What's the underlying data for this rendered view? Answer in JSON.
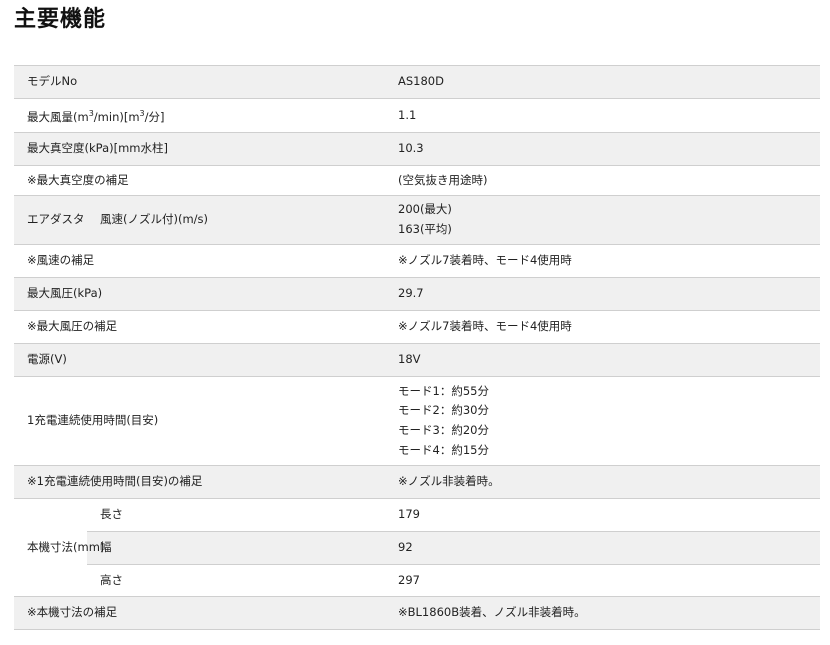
{
  "title": "主要機能",
  "rows": {
    "model": {
      "label": "モデルNo",
      "value": "AS180D"
    },
    "airflow": {
      "label_pre": "最大風量(m",
      "label_sup1": "3",
      "label_mid": "/min)[m",
      "label_sup2": "3",
      "label_post": "/分]",
      "value": "1.1"
    },
    "vacuum": {
      "label": "最大真空度(kPa)[mm水柱]",
      "value": "10.3"
    },
    "vacuum_note": {
      "label": "※最大真空度の補足",
      "value": "(空気抜き用途時)"
    },
    "air_duster": {
      "label": "エアダスタ",
      "sublabel": "風速(ノズル付)(m/s)",
      "values": [
        "200(最大)",
        "163(平均)"
      ]
    },
    "speed_note": {
      "label": "※風速の補足",
      "value": "※ノズル7装着時、モード4使用時"
    },
    "pressure": {
      "label": "最大風圧(kPa)",
      "value": "29.7"
    },
    "pressure_note": {
      "label": "※最大風圧の補足",
      "value": "※ノズル7装着時、モード4使用時"
    },
    "voltage": {
      "label": "電源(V)",
      "value": "18V"
    },
    "runtime": {
      "label": "1充電連続使用時間(目安)",
      "values": [
        "モード1：約55分",
        "モード2：約30分",
        "モード3：約20分",
        "モード4：約15分"
      ]
    },
    "runtime_note": {
      "label": "※1充電連続使用時間(目安)の補足",
      "value": "※ノズル非装着時。"
    },
    "dimensions": {
      "label": "本機寸法(mm)",
      "length": {
        "label": "長さ",
        "value": "179"
      },
      "width": {
        "label": "幅",
        "value": "92"
      },
      "height": {
        "label": "高さ",
        "value": "297"
      }
    },
    "dimensions_note": {
      "label": "※本機寸法の補足",
      "value": "※BL1860B装着、ノズル非装着時。"
    }
  },
  "colors": {
    "shade": "#f0f0f0",
    "border": "#cfcfcf",
    "text": "#222222"
  }
}
